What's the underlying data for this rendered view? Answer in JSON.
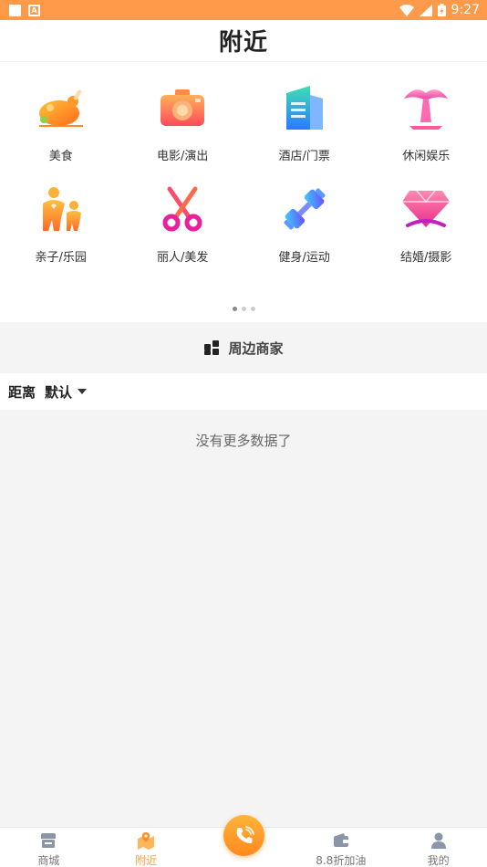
{
  "status_bar": {
    "time": "9:27"
  },
  "header": {
    "title": "附近"
  },
  "categories": [
    {
      "label": "美食",
      "icon": "roast-chicken-icon"
    },
    {
      "label": "电影/演出",
      "icon": "camera-icon"
    },
    {
      "label": "酒店/门票",
      "icon": "building-icon"
    },
    {
      "label": "休闲娱乐",
      "icon": "palm-tree-icon"
    },
    {
      "label": "亲子/乐园",
      "icon": "parent-child-icon"
    },
    {
      "label": "丽人/美发",
      "icon": "scissors-icon"
    },
    {
      "label": "健身/运动",
      "icon": "dumbbell-icon"
    },
    {
      "label": "结婚/摄影",
      "icon": "diamond-icon"
    }
  ],
  "pager": {
    "total": 3,
    "active": 1
  },
  "section": {
    "title": "周边商家"
  },
  "filter": {
    "label": "距离",
    "value": "默认"
  },
  "empty": {
    "text": "没有更多数据了"
  },
  "bottom_nav": [
    {
      "label": "商城",
      "icon": "store-icon",
      "active": false
    },
    {
      "label": "附近",
      "icon": "map-pin-icon",
      "active": true
    },
    {
      "label": "",
      "icon": "phone-icon",
      "active": false
    },
    {
      "label": "8.8折加油",
      "icon": "wallet-icon",
      "active": false
    },
    {
      "label": "我的",
      "icon": "user-icon",
      "active": false
    }
  ],
  "colors": {
    "accent": "#ff9a4a",
    "active_nav": "#ff9c3c"
  }
}
